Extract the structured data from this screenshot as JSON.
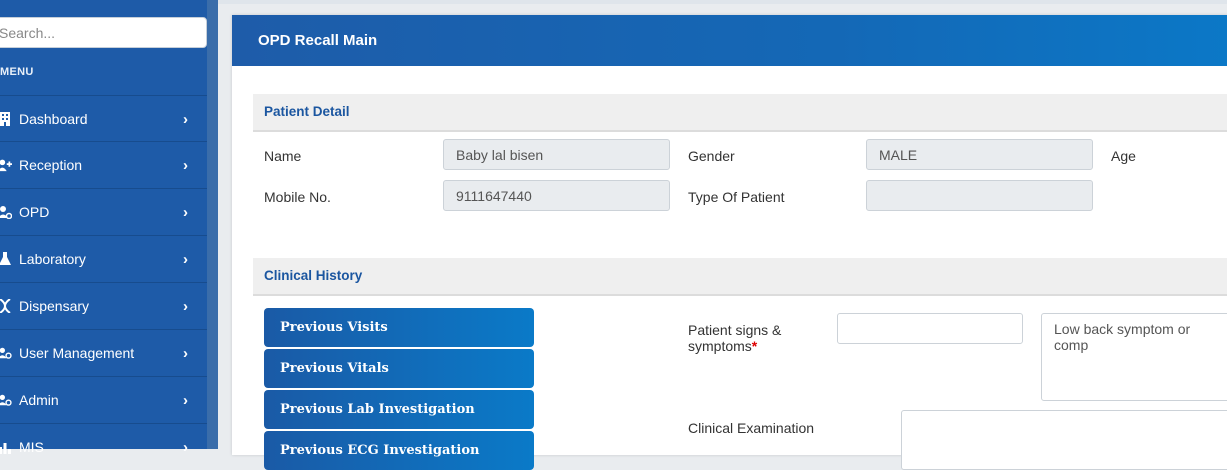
{
  "sidebar": {
    "search_placeholder": "Search...",
    "menu_label": "MENU",
    "items": [
      {
        "label": "Dashboard",
        "icon": "building-icon"
      },
      {
        "label": "Reception",
        "icon": "user-plus-icon"
      },
      {
        "label": "OPD",
        "icon": "user-gear-icon"
      },
      {
        "label": "Laboratory",
        "icon": "flask-icon"
      },
      {
        "label": "Dispensary",
        "icon": "dna-icon"
      },
      {
        "label": "User Management",
        "icon": "users-cog-icon"
      },
      {
        "label": "Admin",
        "icon": "user-cog-icon"
      },
      {
        "label": "MIS",
        "icon": "chart-icon"
      }
    ],
    "chevron": "›"
  },
  "page": {
    "title": "OPD Recall Main"
  },
  "patient_detail": {
    "title": "Patient Detail",
    "name_label": "Name",
    "name_value": "Baby lal bisen",
    "gender_label": "Gender",
    "gender_value": "MALE",
    "age_label": "Age",
    "mobile_label": "Mobile No.",
    "mobile_value": "9111647440",
    "type_label": "Type Of Patient",
    "type_value": ""
  },
  "clinical_history": {
    "title": "Clinical History",
    "buttons": [
      "Previous Visits",
      "Previous Vitals",
      "Previous Lab Investigation",
      "Previous ECG Investigation"
    ],
    "signs_label_1": "Patient signs &",
    "signs_label_2": "symptoms",
    "required_mark": "*",
    "signs_input_value": "",
    "signs_text_value": "Low back symptom or comp",
    "exam_label": "Clinical Examination",
    "exam_value": ""
  },
  "colors": {
    "sidebar_bg": "#1e5ba8",
    "header_bg": "#1e5ca9",
    "section_title": "#1b56a0",
    "required": "#dd0000"
  }
}
